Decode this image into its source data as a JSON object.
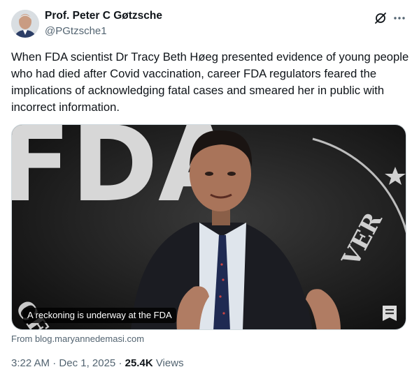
{
  "author": {
    "name": "Prof. Peter C Gøtzsche",
    "handle": "@PGtzsche1"
  },
  "tweet": {
    "text": "When FDA scientist Dr Tracy Beth Høeg presented evidence of young people who had died after Covid vaccination, career FDA regulators feared the implications of acknowledging fatal cases and smeared her in public with incorrect information."
  },
  "card": {
    "caption": "A reckoning is underway at the FDA",
    "source": "From blog.maryannedemasi.com",
    "backdrop_text": "FDA"
  },
  "meta": {
    "time": "3:22 AM",
    "separator": "·",
    "date": "Dec 1, 2025",
    "views_count": "25.4K",
    "views_label": "Views"
  },
  "icons": {
    "grok": "grok-icon",
    "more": "more-icon",
    "article": "article-icon"
  },
  "colors": {
    "text": "#0f1419",
    "secondary": "#536471",
    "border": "#cfd9de"
  }
}
